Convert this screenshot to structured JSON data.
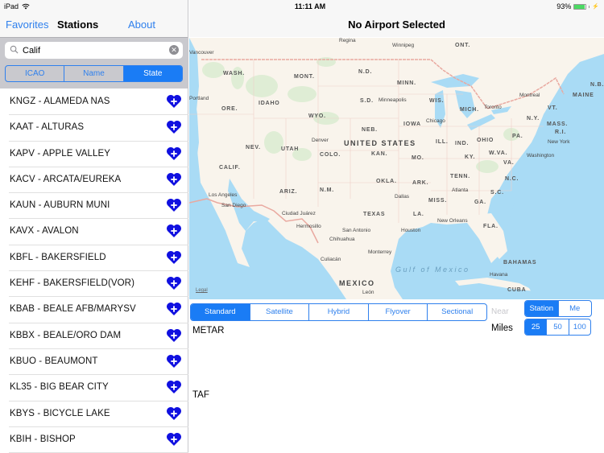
{
  "status_bar": {
    "device": "iPad",
    "time": "11:11 AM",
    "battery_percent_label": "93%",
    "battery_level": 0.93
  },
  "left_nav": {
    "favorites_label": "Favorites",
    "title": "Stations",
    "about_label": "About"
  },
  "search": {
    "value": "Calif",
    "placeholder": "Search"
  },
  "scope": {
    "options": [
      "ICAO",
      "Name",
      "State"
    ],
    "selected": "State"
  },
  "stations": [
    {
      "label": "KNGZ - ALAMEDA NAS"
    },
    {
      "label": "KAAT - ALTURAS"
    },
    {
      "label": "KAPV - APPLE VALLEY"
    },
    {
      "label": "KACV - ARCATA/EUREKA"
    },
    {
      "label": "KAUN - AUBURN MUNI"
    },
    {
      "label": "KAVX - AVALON"
    },
    {
      "label": "KBFL - BAKERSFIELD"
    },
    {
      "label": "KEHF - BAKERSFIELD(VOR)"
    },
    {
      "label": "KBAB - BEALE AFB/MARYSV"
    },
    {
      "label": "KBBX - BEALE/ORO DAM"
    },
    {
      "label": "KBUO - BEAUMONT"
    },
    {
      "label": "KL35 - BIG BEAR CITY"
    },
    {
      "label": "KBYS - BICYCLE LAKE"
    },
    {
      "label": "KBIH - BISHOP"
    }
  ],
  "favorite_icon_color": "#1010e0",
  "detail": {
    "title": "No Airport Selected"
  },
  "map": {
    "legal_label": "Legal",
    "state_labels": [
      "WASH.",
      "ORE.",
      "IDAHO",
      "MONT.",
      "WYO.",
      "N.D.",
      "S.D.",
      "NEB.",
      "KAN.",
      "MINN.",
      "IOWA",
      "WIS.",
      "MICH.",
      "ILL.",
      "IND.",
      "OHIO",
      "PA.",
      "N.Y.",
      "VT.",
      "MAINE",
      "MASS.",
      "R.I.",
      "N.B.",
      "ONT.",
      "NEV.",
      "UTAH",
      "COLO.",
      "CALIF.",
      "ARIZ.",
      "N.M.",
      "OKLA.",
      "TEXAS",
      "MO.",
      "KY.",
      "W.VA.",
      "VA.",
      "TENN.",
      "N.C.",
      "S.C.",
      "ARK.",
      "MISS.",
      "GA.",
      "LA.",
      "FLA."
    ],
    "country_labels": [
      "UNITED STATES",
      "MEXICO",
      "BAHAMAS",
      "CUBA"
    ],
    "water_labels": [
      "Gulf of Mexico"
    ],
    "cities": [
      "Vancouver",
      "Portland",
      "Regina",
      "Winnipeg",
      "Minneapolis",
      "Chicago",
      "Toronto",
      "Montreal",
      "New York",
      "Washington",
      "Denver",
      "Los Angeles",
      "San Diego",
      "Ciudad Juárez",
      "Hermosillo",
      "Chihuahua",
      "San Antonio",
      "Dallas",
      "Houston",
      "Monterrey",
      "Culiacán",
      "Atlanta",
      "New Orleans",
      "Havana",
      "León"
    ]
  },
  "map_type": {
    "options": [
      "Standard",
      "Satellite",
      "Hybrid",
      "Flyover",
      "Sectional"
    ],
    "selected": "Standard"
  },
  "near": {
    "label": "Near",
    "options": [
      "Station",
      "Me"
    ],
    "selected": "Station"
  },
  "miles": {
    "label": "Miles",
    "options": [
      "25",
      "50",
      "100"
    ],
    "selected": "25"
  },
  "sections": {
    "metar_label": "METAR",
    "taf_label": "TAF"
  }
}
